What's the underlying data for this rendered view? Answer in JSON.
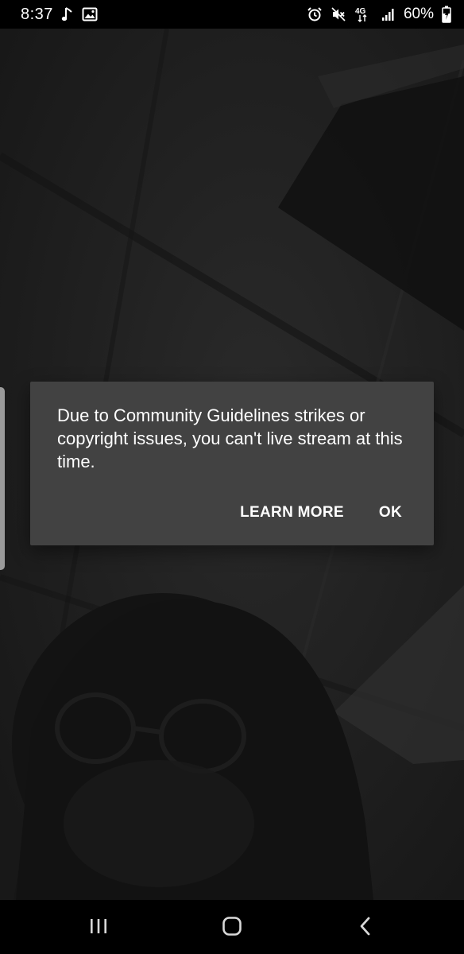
{
  "status_bar": {
    "time": "8:37",
    "battery_percent": "60%",
    "network_label": "4G",
    "left_icons": [
      "music-note-icon",
      "image-icon"
    ],
    "right_icons": [
      "alarm-icon",
      "mute-icon",
      "network-4g-icon",
      "signal-icon",
      "battery-charging-icon"
    ]
  },
  "dialog": {
    "message": "Due to Community Guidelines strikes or copyright issues, you can't live stream at this time.",
    "learn_more_label": "LEARN MORE",
    "ok_label": "OK"
  },
  "nav_bar": {
    "buttons": [
      "recent-apps",
      "home",
      "back"
    ]
  },
  "colors": {
    "dialog_bg": "#424242",
    "bars_bg": "#000000",
    "camera_bg": "#1e1e1e",
    "text": "#ffffff"
  }
}
